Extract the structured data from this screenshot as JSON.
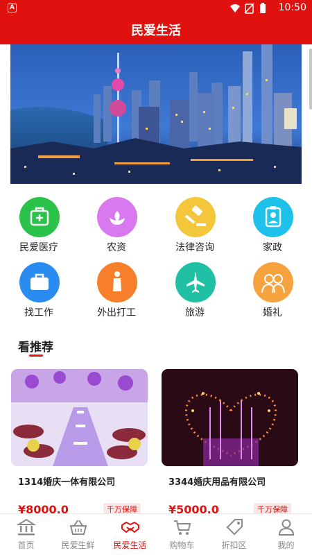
{
  "status_bar": {
    "time": "10:50",
    "app_icon": "A"
  },
  "header": {
    "title": "民爱生活"
  },
  "services": [
    {
      "label": "民爱医疗",
      "icon": "medical-kit-icon",
      "color": "#2bc24a"
    },
    {
      "label": "农资",
      "icon": "sprout-icon",
      "color": "#d979ef"
    },
    {
      "label": "法律咨询",
      "icon": "gavel-icon",
      "color": "#f4c63b"
    },
    {
      "label": "家政",
      "icon": "id-badge-icon",
      "color": "#1ec1ea"
    },
    {
      "label": "找工作",
      "icon": "briefcase-icon",
      "color": "#2a8cf0"
    },
    {
      "label": "外出打工",
      "icon": "person-icon",
      "color": "#f77e2b"
    },
    {
      "label": "旅游",
      "icon": "airplane-icon",
      "color": "#20c0a4"
    },
    {
      "label": "婚礼",
      "icon": "couple-icon",
      "color": "#f6a23f"
    }
  ],
  "recommend": {
    "title": "看推荐"
  },
  "products": [
    {
      "name": "1314婚庆一体有限公司",
      "price": "¥8000.0",
      "badge": "千万保障"
    },
    {
      "name": "3344婚庆用品有限公司",
      "price": "¥5000.0",
      "badge": "千万保障"
    }
  ],
  "bottom_nav": [
    {
      "label": "首页",
      "icon": "bank-icon"
    },
    {
      "label": "民爱生鲜",
      "icon": "basket-icon"
    },
    {
      "label": "民爱生活",
      "icon": "handshake-icon",
      "active": true
    },
    {
      "label": "购物车",
      "icon": "cart-icon"
    },
    {
      "label": "折扣区",
      "icon": "tag-icon"
    },
    {
      "label": "我的",
      "icon": "user-icon"
    }
  ],
  "colors": {
    "brand": "#e0120f",
    "nav_inactive": "#8a8a8a"
  }
}
